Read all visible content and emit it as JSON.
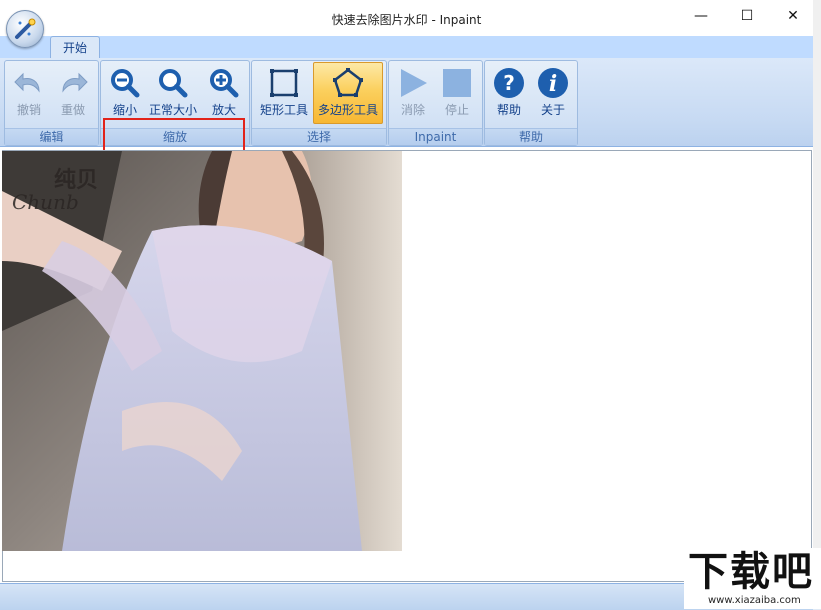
{
  "window": {
    "title": "快速去除图片水印 - Inpaint",
    "minimize_glyph": "—",
    "maximize_glyph": "☐",
    "close_glyph": "✕"
  },
  "tabs": [
    {
      "label": "开始"
    }
  ],
  "ribbon": {
    "groups": [
      {
        "label": "编辑",
        "buttons": [
          {
            "label": "撤销",
            "icon": "undo-icon",
            "enabled": false
          },
          {
            "label": "重做",
            "icon": "redo-icon",
            "enabled": false
          }
        ]
      },
      {
        "label": "缩放",
        "buttons": [
          {
            "label": "缩小",
            "icon": "zoom-out-icon",
            "enabled": true
          },
          {
            "label": "正常大小",
            "icon": "zoom-normal-icon",
            "enabled": true
          },
          {
            "label": "放大",
            "icon": "zoom-in-icon",
            "enabled": true
          }
        ]
      },
      {
        "label": "选择",
        "buttons": [
          {
            "label": "矩形工具",
            "icon": "rectangle-tool-icon",
            "enabled": true
          },
          {
            "label": "多边形工具",
            "icon": "polygon-tool-icon",
            "enabled": true,
            "selected": true
          }
        ]
      },
      {
        "label": "Inpaint",
        "buttons": [
          {
            "label": "消除",
            "icon": "play-icon",
            "enabled": false
          },
          {
            "label": "停止",
            "icon": "stop-icon",
            "enabled": false
          }
        ]
      },
      {
        "label": "帮助",
        "buttons": [
          {
            "label": "帮助",
            "icon": "help-icon",
            "enabled": true
          },
          {
            "label": "关于",
            "icon": "info-icon",
            "enabled": true
          }
        ]
      }
    ]
  },
  "image": {
    "watermark_text_line1": "纯贝",
    "watermark_text_line2": "Chunb"
  },
  "site_watermark": {
    "big_text": "下载吧",
    "url": "www.xiazaiba.com"
  },
  "colors": {
    "ribbon_text": "#15428b",
    "highlight": "#e2231a",
    "selected_button": "#fbd05e"
  }
}
